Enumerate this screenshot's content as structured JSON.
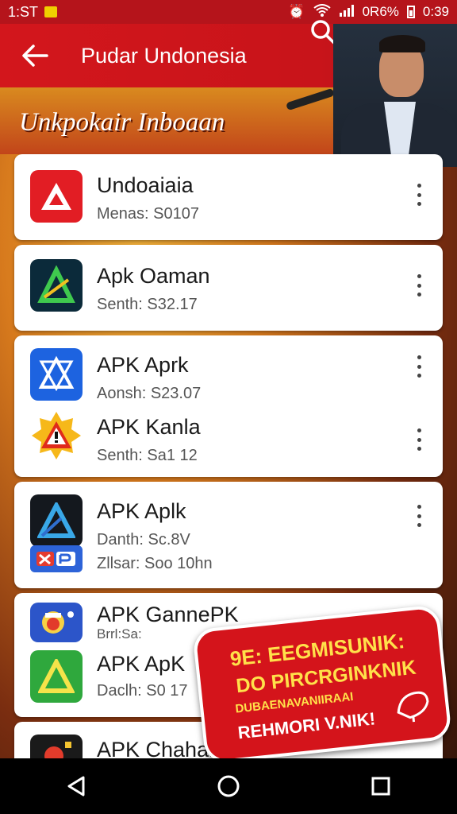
{
  "status_bar": {
    "time_left": "1:ST",
    "battery_text": "0R6%",
    "clock": "0:39"
  },
  "app_bar": {
    "title": "Pudar Undonesia"
  },
  "hero": {
    "banner_text": "Unkpokair Inboaan"
  },
  "apps": [
    {
      "name": "Undoaiaia",
      "meta": "Menas: S0107"
    },
    {
      "name": "Apk Oaman",
      "meta": "Senth: S32.17"
    },
    {
      "name": "APK Aprk",
      "meta": "Aonsh: S23.07"
    },
    {
      "name": "APK Kanla",
      "meta": "Senth: Sa1 12"
    },
    {
      "name": "APK Aplk",
      "meta": "Danth: Sc.8V"
    },
    {
      "name": "",
      "meta": "Zllsar: Soo 10hn"
    },
    {
      "name": "APK GannePK",
      "meta": "Brrl:Sa:"
    },
    {
      "name": "APK ApK",
      "meta": "Daclh: S0 17"
    },
    {
      "name": "APK Chahan",
      "meta": ""
    }
  ],
  "promo": {
    "line1": "9E: EEGMISUNIK:",
    "line2": "DO PIRCRGINKNIK",
    "line3": "DUBAENAVANIIRAAI",
    "line4": "REHMORI V.NIK!"
  },
  "colors": {
    "brand_red": "#d3161c",
    "status_red": "#b5141b",
    "promo_yellow": "#ffe14a"
  }
}
